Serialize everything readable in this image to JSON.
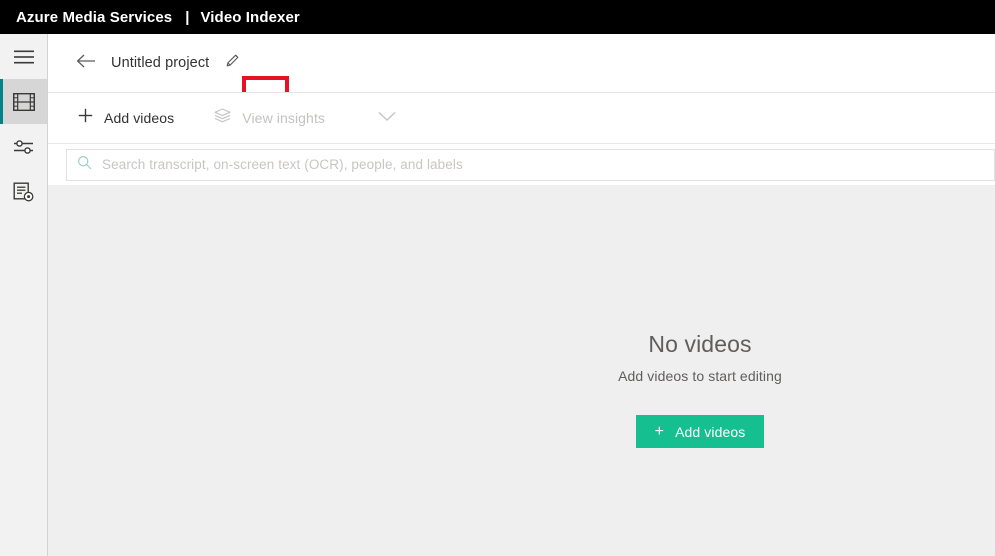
{
  "topbar": {
    "brand": "Azure Media Services",
    "separator": "|",
    "product": "Video Indexer"
  },
  "sidebar": {
    "items": [
      {
        "icon": "hamburger-menu-icon",
        "name": "menu",
        "active": false
      },
      {
        "icon": "film-strip-icon",
        "name": "media",
        "active": true
      },
      {
        "icon": "sliders-icon",
        "name": "customization",
        "active": false
      },
      {
        "icon": "document-settings-icon",
        "name": "report",
        "active": false
      }
    ],
    "active_indicator_color": "#038387"
  },
  "project_header": {
    "back_icon": "arrow-left-icon",
    "title": "Untitled project",
    "edit_icon": "pencil-icon",
    "annotation_color": "#e81123"
  },
  "command_bar": {
    "add_videos": {
      "icon": "plus-icon",
      "label": "Add videos",
      "enabled": true
    },
    "view_insights": {
      "icon": "layers-icon",
      "label": "View insights",
      "enabled": false
    },
    "overflow_icon": "chevron-down-icon"
  },
  "search": {
    "icon": "search-icon",
    "value": "",
    "placeholder": "Search transcript, on-screen text (OCR), people, and labels"
  },
  "empty_state": {
    "title": "No videos",
    "subtitle": "Add videos to start editing",
    "button_label": "Add videos",
    "button_icon": "plus-icon",
    "button_color": "#15bf8f"
  }
}
